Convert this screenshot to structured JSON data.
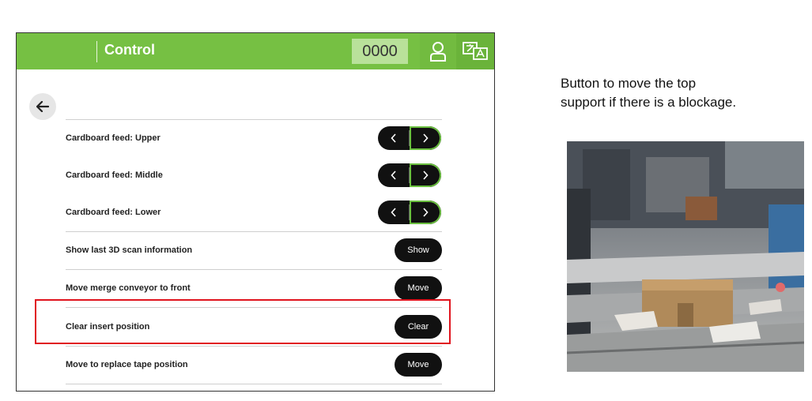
{
  "header": {
    "title": "Control",
    "counter": "0000"
  },
  "rows": [
    {
      "label": "Cardboard feed: Upper"
    },
    {
      "label": "Cardboard feed: Middle"
    },
    {
      "label": "Cardboard feed: Lower"
    },
    {
      "label": "Show last 3D scan information",
      "button": "Show"
    },
    {
      "label": "Move merge conveyor to front",
      "button": "Move"
    },
    {
      "label": "Clear insert position",
      "button": "Clear"
    },
    {
      "label": "Move to replace tape position",
      "button": "Move"
    }
  ],
  "annotation": {
    "line1": "Button to move the top",
    "line2": "support if there is a blockage."
  },
  "colors": {
    "accent": "#76c043",
    "highlight": "#e0141e"
  },
  "icons": {
    "user": "user-icon",
    "language": "language-icon",
    "back": "back-arrow-icon"
  }
}
